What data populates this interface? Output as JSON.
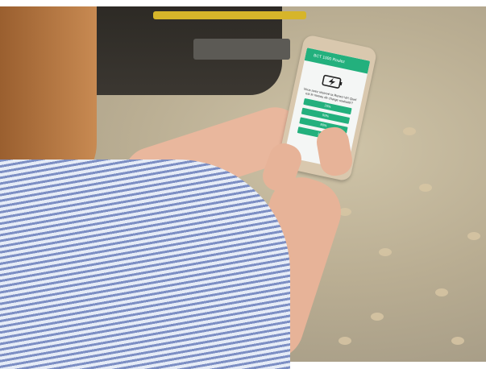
{
  "app": {
    "title": "BCT 1000 Roulez",
    "status_right": "",
    "question": "Vous avez réservé ta Renez-Vir! Quel est le niveau de charge souhaité?",
    "icon": "battery-charging-icon",
    "options": [
      "20%",
      "50%",
      "80%",
      "100%"
    ]
  },
  "colors": {
    "accent": "#23b07d",
    "phone_body": "#d9c8ae"
  }
}
